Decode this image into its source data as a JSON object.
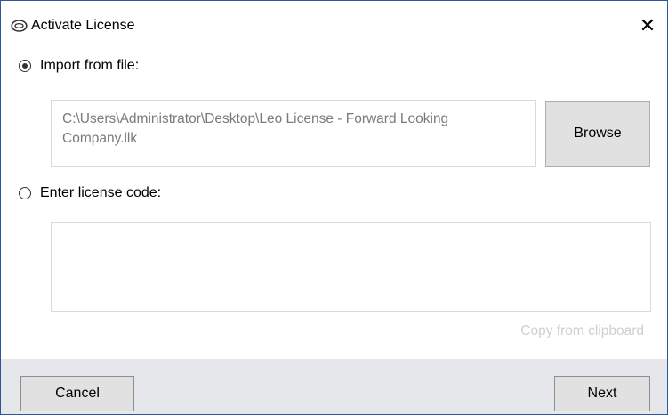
{
  "window": {
    "title": "Activate License",
    "app_icon": "license-key-icon",
    "close_icon": "close-icon",
    "close_glyph": "✕"
  },
  "import_option": {
    "label": "Import from file:",
    "selected": true
  },
  "file_path": {
    "value": "C:\\Users\\Administrator\\Desktop\\Leo License - Forward Looking Company.llk"
  },
  "browse_button": {
    "label": "Browse"
  },
  "enter_code_option": {
    "label": "Enter license code:",
    "selected": false
  },
  "license_code": {
    "value": ""
  },
  "copy_from_clipboard": {
    "label": "Copy from clipboard",
    "enabled": false
  },
  "footer": {
    "cancel_label": "Cancel",
    "next_label": "Next"
  },
  "colors": {
    "window_border": "#2b579a",
    "footer_bg": "#e6e7ea",
    "button_bg": "#e1e1e1",
    "disabled_text": "#cfcfcf",
    "path_text": "#7a7a7a"
  }
}
